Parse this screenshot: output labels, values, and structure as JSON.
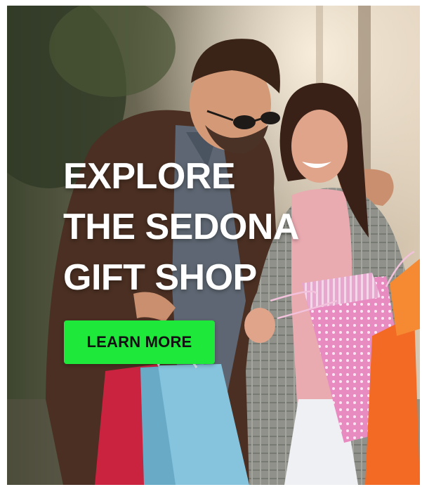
{
  "banner": {
    "headline_lines": [
      "EXPLORE",
      "THE SEDONA",
      "GIFT SHOP"
    ],
    "cta_label": "LEARN MORE"
  },
  "colors": {
    "cta_background": "#1ee83a",
    "headline": "#ffffff",
    "cta_text": "#111111"
  },
  "icons": {
    "sunglasses": "sunglasses-icon",
    "shopping_bags": "shopping-bag-icon"
  }
}
